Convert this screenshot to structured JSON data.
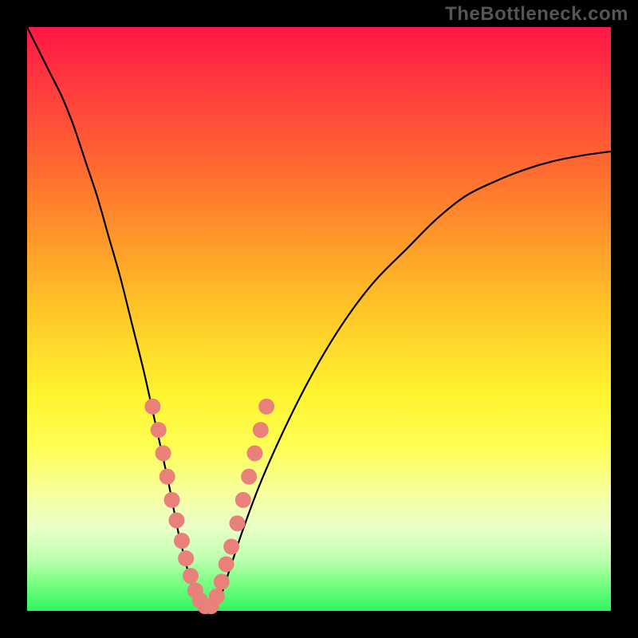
{
  "watermark": "TheBottleneck.com",
  "chart_data": {
    "type": "line",
    "title": "",
    "xlabel": "",
    "ylabel": "",
    "xlim": [
      0,
      100
    ],
    "ylim": [
      0,
      100
    ],
    "background_gradient": {
      "top": "#ff1745",
      "bottom": "#30f55e",
      "stops": [
        "#ff1745",
        "#ff3a3e",
        "#ff6a30",
        "#ff9729",
        "#ffc428",
        "#fff42f",
        "#fdff55",
        "#f6ffa0",
        "#e8ffc8",
        "#bfffb0",
        "#7dff85",
        "#30f55e"
      ]
    },
    "series": [
      {
        "name": "bottleneck-curve",
        "x": [
          0,
          2,
          4,
          6,
          8,
          10,
          12,
          14,
          16,
          18,
          20,
          22,
          24,
          25,
          26,
          27,
          28,
          29,
          30,
          31,
          32,
          33,
          34,
          35,
          37,
          40,
          44,
          48,
          52,
          56,
          60,
          65,
          70,
          75,
          80,
          85,
          90,
          95,
          100
        ],
        "values": [
          100,
          96,
          92,
          88,
          83,
          77,
          71,
          64,
          57,
          49,
          41,
          32,
          23,
          18,
          13,
          9,
          5,
          2,
          0,
          0,
          0,
          2,
          5,
          8,
          14,
          22,
          31,
          39,
          46,
          52,
          57,
          62,
          67,
          71,
          73.5,
          75.5,
          77,
          78,
          78.7
        ]
      }
    ],
    "markers": {
      "name": "highlight-dots",
      "color": "#e98079",
      "radius": 10,
      "points": [
        {
          "x": 21.5,
          "y": 35
        },
        {
          "x": 22.5,
          "y": 31
        },
        {
          "x": 23.3,
          "y": 27
        },
        {
          "x": 24.0,
          "y": 23
        },
        {
          "x": 24.8,
          "y": 19
        },
        {
          "x": 25.6,
          "y": 15.5
        },
        {
          "x": 26.5,
          "y": 12
        },
        {
          "x": 27.2,
          "y": 9
        },
        {
          "x": 28.0,
          "y": 6
        },
        {
          "x": 28.8,
          "y": 3.5
        },
        {
          "x": 29.6,
          "y": 1.8
        },
        {
          "x": 30.5,
          "y": 0.8
        },
        {
          "x": 31.5,
          "y": 0.8
        },
        {
          "x": 32.5,
          "y": 2.5
        },
        {
          "x": 33.3,
          "y": 5
        },
        {
          "x": 34.1,
          "y": 8
        },
        {
          "x": 35.0,
          "y": 11
        },
        {
          "x": 36.0,
          "y": 15
        },
        {
          "x": 37.0,
          "y": 19
        },
        {
          "x": 38.0,
          "y": 23
        },
        {
          "x": 39.0,
          "y": 27
        },
        {
          "x": 40.0,
          "y": 31
        },
        {
          "x": 41.0,
          "y": 35
        }
      ]
    }
  }
}
